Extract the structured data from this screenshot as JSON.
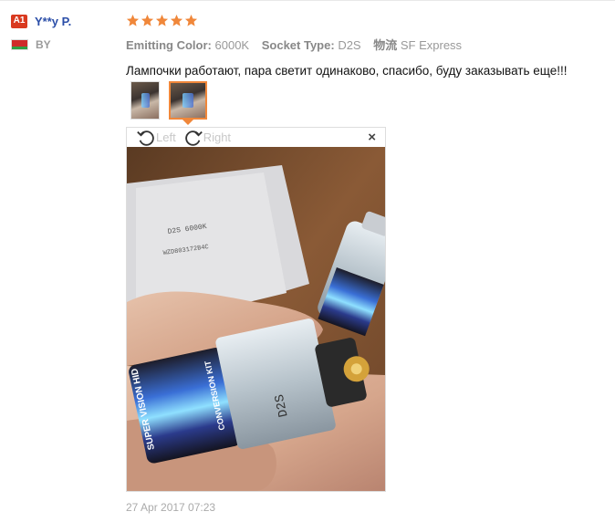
{
  "buyer": {
    "level_badge": "A1",
    "name": "Y**y P.",
    "country_code": "BY"
  },
  "review": {
    "rating": 5,
    "attributes": [
      {
        "key": "Emitting Color:",
        "value": "6000K"
      },
      {
        "key": "Socket Type:",
        "value": "D2S"
      },
      {
        "key": "物流",
        "value": "SF Express"
      }
    ],
    "text": "Лампочки работают, пара светит одинаково, спасибо, буду заказывать еще!!!",
    "date": "27 Apr 2017 07:23"
  },
  "viewer": {
    "rotate_left_label": "Left",
    "rotate_right_label": "Right",
    "close_symbol": "×",
    "photo_box_text_1": "D2S 6000K",
    "photo_box_text_2": "WZD803172B4C",
    "photo_bulb_label": "D2S",
    "photo_bulb_brand": "SUPER VISION HID",
    "photo_bulb_kit": "CONVERSION KIT"
  },
  "colors": {
    "accent": "#f0873a",
    "star": "#f0873a",
    "badge": "#d9391f",
    "name": "#2b4ea8"
  },
  "icons": {
    "star": "star-icon",
    "rotate_left": "rotate-left-icon",
    "rotate_right": "rotate-right-icon",
    "close": "close-icon",
    "flag": "belarus-flag-icon"
  }
}
